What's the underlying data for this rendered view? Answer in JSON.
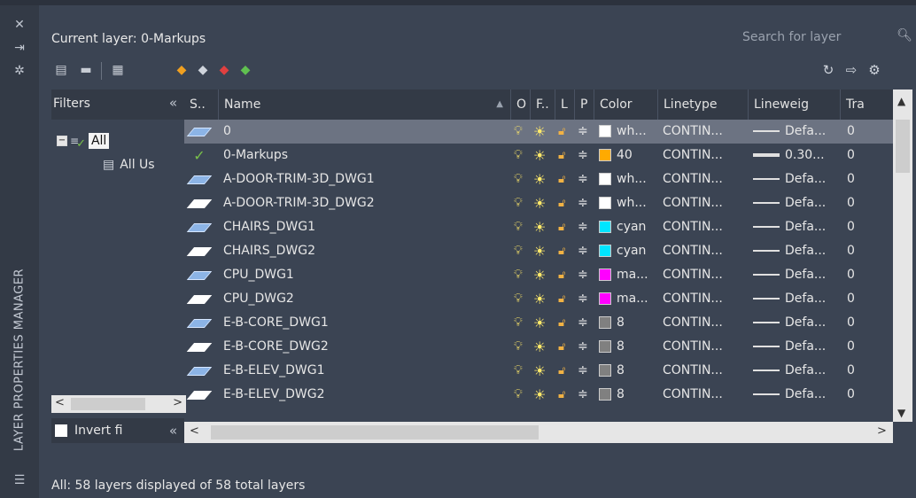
{
  "palette": {
    "accent": "#6c7382",
    "panel_bg": "#3b4453",
    "header_bg": "#333a46"
  },
  "palette_title": "LAYER PROPERTIES MANAGER",
  "palette_icons": [
    "close-icon",
    "auto-hide-icon",
    "properties-icon"
  ],
  "current_layer": "Current layer: 0-Markups",
  "search": {
    "placeholder": "Search for layer",
    "value": ""
  },
  "toolbar_icons": [
    "new-property-filter-icon",
    "new-group-filter-icon",
    "layer-states-manager-icon",
    "new-layer-icon",
    "new-layer-vp-frozen-icon",
    "delete-layer-icon",
    "set-current-icon"
  ],
  "right_toolbar_icons": [
    "refresh-icon",
    "settings-icon"
  ],
  "filters": {
    "header": "Filters",
    "collapse": "«",
    "all": "All",
    "all_used": "All Us",
    "invert": "Invert fi",
    "invert_checked": false
  },
  "columns": [
    "S..",
    "Name",
    "O",
    "F..",
    "L",
    "P",
    "Color",
    "Linetype",
    "Lineweig",
    "Tra"
  ],
  "rows": [
    {
      "name": "0",
      "status": "plane",
      "color_name": "wh...",
      "color": "#ffffff",
      "linetype": "CONTIN...",
      "lineweight": "Defa...",
      "lw_thick": false,
      "trans": "0",
      "selected": true
    },
    {
      "name": "0-Markups",
      "status": "current",
      "color_name": "40",
      "color": "#ffaa00",
      "linetype": "CONTIN...",
      "lineweight": "0.30...",
      "lw_thick": true,
      "trans": "0",
      "selected": false
    },
    {
      "name": "A-DOOR-TRIM-3D_DWG1",
      "status": "plane",
      "color_name": "wh...",
      "color": "#ffffff",
      "linetype": "CONTIN...",
      "lineweight": "Defa...",
      "lw_thick": false,
      "trans": "0",
      "selected": false
    },
    {
      "name": "A-DOOR-TRIM-3D_DWG2",
      "status": "plane-white",
      "color_name": "wh...",
      "color": "#ffffff",
      "linetype": "CONTIN...",
      "lineweight": "Defa...",
      "lw_thick": false,
      "trans": "0",
      "selected": false
    },
    {
      "name": "CHAIRS_DWG1",
      "status": "plane",
      "color_name": "cyan",
      "color": "#00e5ff",
      "linetype": "CONTIN...",
      "lineweight": "Defa...",
      "lw_thick": false,
      "trans": "0",
      "selected": false
    },
    {
      "name": "CHAIRS_DWG2",
      "status": "plane-white",
      "color_name": "cyan",
      "color": "#00e5ff",
      "linetype": "CONTIN...",
      "lineweight": "Defa...",
      "lw_thick": false,
      "trans": "0",
      "selected": false
    },
    {
      "name": "CPU_DWG1",
      "status": "plane",
      "color_name": "ma...",
      "color": "#ff00ff",
      "linetype": "CONTIN...",
      "lineweight": "Defa...",
      "lw_thick": false,
      "trans": "0",
      "selected": false
    },
    {
      "name": "CPU_DWG2",
      "status": "plane-white",
      "color_name": "ma...",
      "color": "#ff00ff",
      "linetype": "CONTIN...",
      "lineweight": "Defa...",
      "lw_thick": false,
      "trans": "0",
      "selected": false
    },
    {
      "name": "E-B-CORE_DWG1",
      "status": "plane",
      "color_name": "8",
      "color": "#808080",
      "linetype": "CONTIN...",
      "lineweight": "Defa...",
      "lw_thick": false,
      "trans": "0",
      "selected": false
    },
    {
      "name": "E-B-CORE_DWG2",
      "status": "plane-white",
      "color_name": "8",
      "color": "#808080",
      "linetype": "CONTIN...",
      "lineweight": "Defa...",
      "lw_thick": false,
      "trans": "0",
      "selected": false
    },
    {
      "name": "E-B-ELEV_DWG1",
      "status": "plane",
      "color_name": "8",
      "color": "#808080",
      "linetype": "CONTIN...",
      "lineweight": "Defa...",
      "lw_thick": false,
      "trans": "0",
      "selected": false
    },
    {
      "name": "E-B-ELEV_DWG2",
      "status": "plane-white",
      "color_name": "8",
      "color": "#808080",
      "linetype": "CONTIN...",
      "lineweight": "Defa...",
      "lw_thick": false,
      "trans": "0",
      "selected": false
    }
  ],
  "status_text": "All: 58 layers displayed of 58 total layers"
}
